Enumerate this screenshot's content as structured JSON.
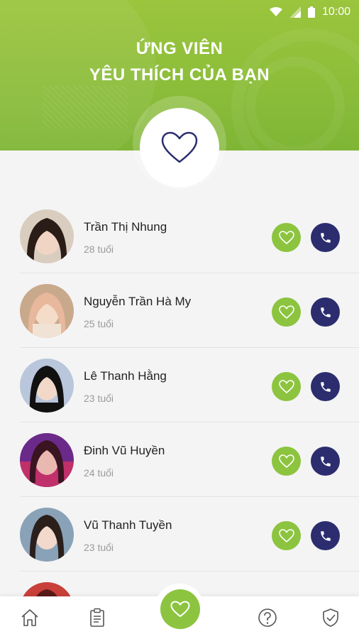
{
  "status_bar": {
    "time": "10:00"
  },
  "header": {
    "title_line1": "ỨNG VIÊN",
    "title_line2": "YÊU THÍCH CỦA BẠN"
  },
  "candidates": [
    {
      "name": "Trần Thị Nhung",
      "age": "28 tuổi"
    },
    {
      "name": "Nguyễn Trần Hà My",
      "age": "25 tuổi"
    },
    {
      "name": "Lê Thanh Hằng",
      "age": "23 tuổi"
    },
    {
      "name": "Đinh Vũ Huyền",
      "age": "24 tuổi"
    },
    {
      "name": "Vũ Thanh Tuyền",
      "age": "23 tuổi"
    }
  ],
  "colors": {
    "primary_green": "#8cc43f",
    "dark_navy": "#2b2d6e"
  },
  "bottom_nav": [
    "home-icon",
    "clipboard-icon",
    "heart-icon",
    "question-icon",
    "shield-check-icon"
  ]
}
